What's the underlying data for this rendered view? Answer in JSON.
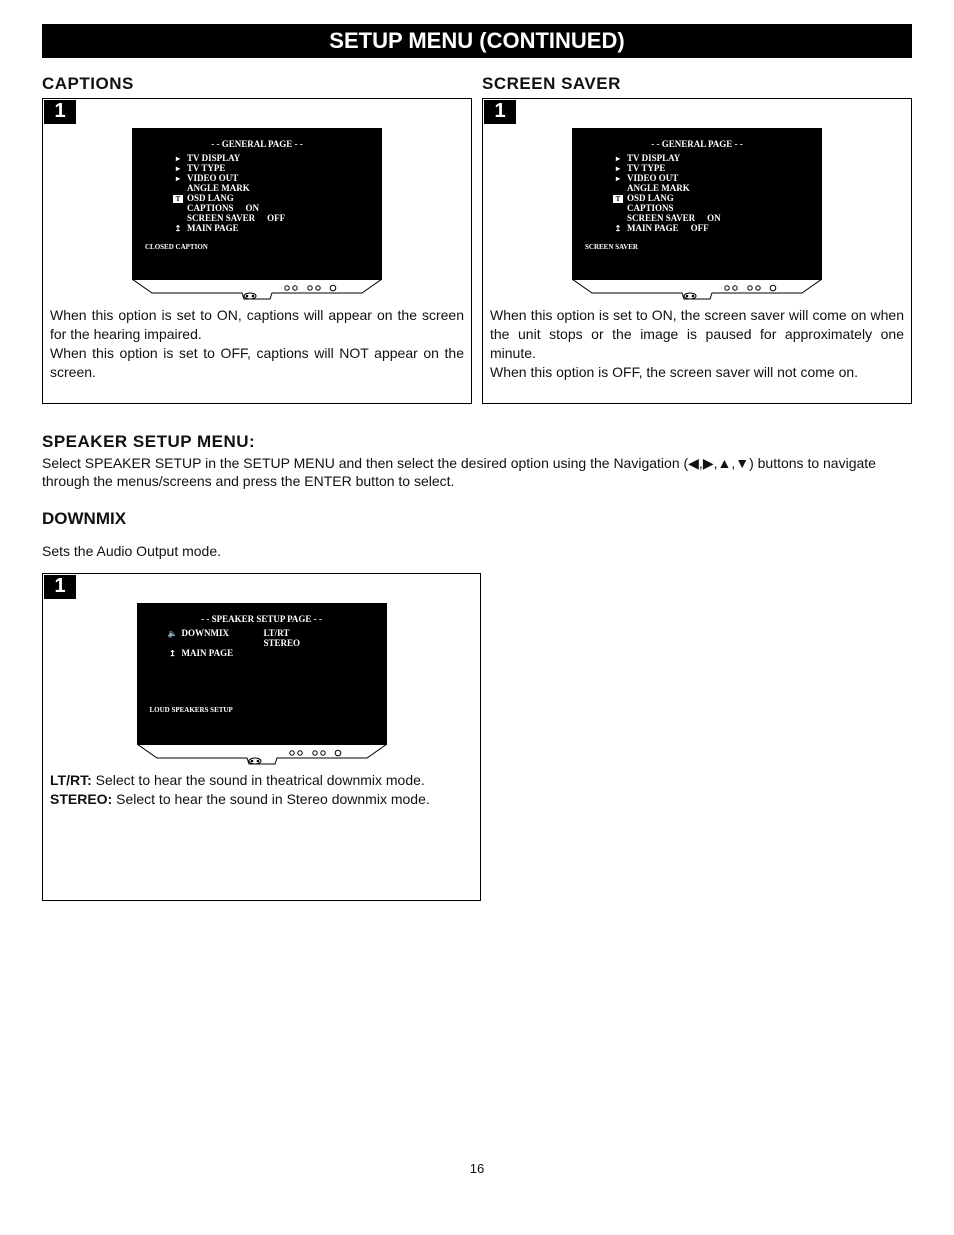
{
  "title": "SETUP MENU (CONTINUED)",
  "step_num": "1",
  "captions": {
    "label": "CAPTIONS",
    "screen_title": "- - GENERAL PAGE - -",
    "items": [
      "TV DISPLAY",
      "TV TYPE",
      "VIDEO OUT",
      "ANGLE MARK",
      "OSD LANG",
      "CAPTIONS",
      "SCREEN SAVER",
      "MAIN PAGE"
    ],
    "val_on": "ON",
    "val_off": "OFF",
    "footer": "CLOSED CAPTION",
    "desc_on": "When this option is set to ON, captions will appear on the screen for the hearing impaired.",
    "desc_off": "When this option is set to OFF, captions will NOT appear on the screen."
  },
  "screensaver": {
    "label": "SCREEN SAVER",
    "screen_title": "- - GENERAL PAGE - -",
    "items": [
      "TV DISPLAY",
      "TV TYPE",
      "VIDEO OUT",
      "ANGLE MARK",
      "OSD LANG",
      "CAPTIONS",
      "SCREEN SAVER",
      "MAIN PAGE"
    ],
    "val_on": "ON",
    "val_off": "OFF",
    "footer": "SCREEN SAVER",
    "desc_on": "When this option is set to ON, the screen saver will come on when the unit stops or the image is paused for approximately one minute.",
    "desc_off": "When this option is OFF, the screen saver will not come on."
  },
  "speaker": {
    "label": "SPEAKER SETUP MENU:",
    "desc_a": "Select SPEAKER SETUP in the SETUP MENU and then select the desired option using the Navigation (",
    "desc_b": ") buttons to navigate through the menus/screens and press the ENTER button to select.",
    "nav_symbols": "◀,▶,▲,▼"
  },
  "downmix": {
    "label": "DOWNMIX",
    "intro": "Sets the Audio Output mode.",
    "screen_title": "- - SPEAKER SETUP PAGE - -",
    "items": [
      "DOWNMIX",
      "MAIN PAGE"
    ],
    "opt1": "LT/RT",
    "opt2": "STEREO",
    "footer": "LOUD SPEAKERS SETUP",
    "d1_label": "LT/RT:",
    "d1_text": " Select to hear the sound in theatrical downmix mode.",
    "d2_label": "STEREO:",
    "d2_text": " Select to hear the sound in Stereo downmix mode."
  },
  "page_number": "16"
}
